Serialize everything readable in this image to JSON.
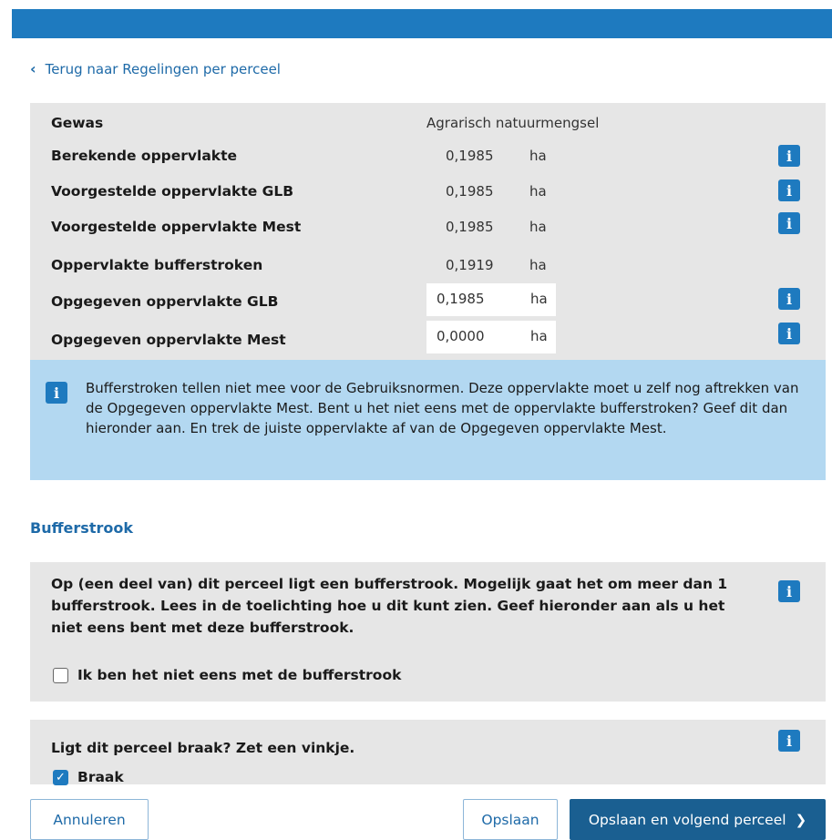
{
  "back_link": {
    "label": "Terug naar Regelingen per perceel"
  },
  "area_table": {
    "crop_label": "Gewas",
    "crop_value": "Agrarisch natuurmengsel",
    "rows": [
      {
        "label": "Berekende oppervlakte",
        "value": "0,1985",
        "unit": "ha",
        "info": true
      },
      {
        "label": "Voorgestelde oppervlakte GLB",
        "value": "0,1985",
        "unit": "ha",
        "info": true
      },
      {
        "label": "Voorgestelde oppervlakte Mest",
        "value": "0,1985",
        "unit": "ha",
        "info": true
      },
      {
        "label": "Oppervlakte bufferstroken",
        "value": "0,1919",
        "unit": "ha",
        "info": false
      }
    ],
    "inputs": [
      {
        "label": "Opgegeven oppervlakte GLB",
        "value": "0,1985",
        "unit": "ha"
      },
      {
        "label": "Opgegeven oppervlakte Mest",
        "value": "0,0000",
        "unit": "ha"
      }
    ],
    "info_symbol": "i"
  },
  "notice": {
    "text": "Bufferstroken tellen niet mee voor de Gebruiksnormen. Deze oppervlakte moet u zelf nog aftrekken van de Opgegeven oppervlakte Mest. Bent u het niet eens met de oppervlakte bufferstroken? Geef dit dan hieronder aan. En trek de juiste oppervlakte af van de Opgegeven oppervlakte Mest."
  },
  "bufferstrook": {
    "title": "Bufferstrook",
    "text": "Op (een deel van) dit perceel ligt een bufferstrook. Mogelijk gaat het om meer dan 1 bufferstrook. Lees in de toelichting hoe u dit kunt zien. Geef hieronder aan als u het niet eens bent met deze bufferstrook.",
    "checkbox_label": "Ik ben het niet eens met de bufferstrook",
    "checked": false
  },
  "braak": {
    "question": "Ligt dit perceel braak? Zet een vinkje.",
    "checkbox_label": "Braak",
    "checked": true
  },
  "footer": {
    "cancel_label": "Annuleren",
    "save_label": "Opslaan",
    "save_next_label": "Opslaan en volgend perceel"
  },
  "colors": {
    "accent": "#1e7abf",
    "primary_button": "#1a5f91",
    "panel": "#e6e6e6",
    "notice": "#b3d8f1"
  }
}
